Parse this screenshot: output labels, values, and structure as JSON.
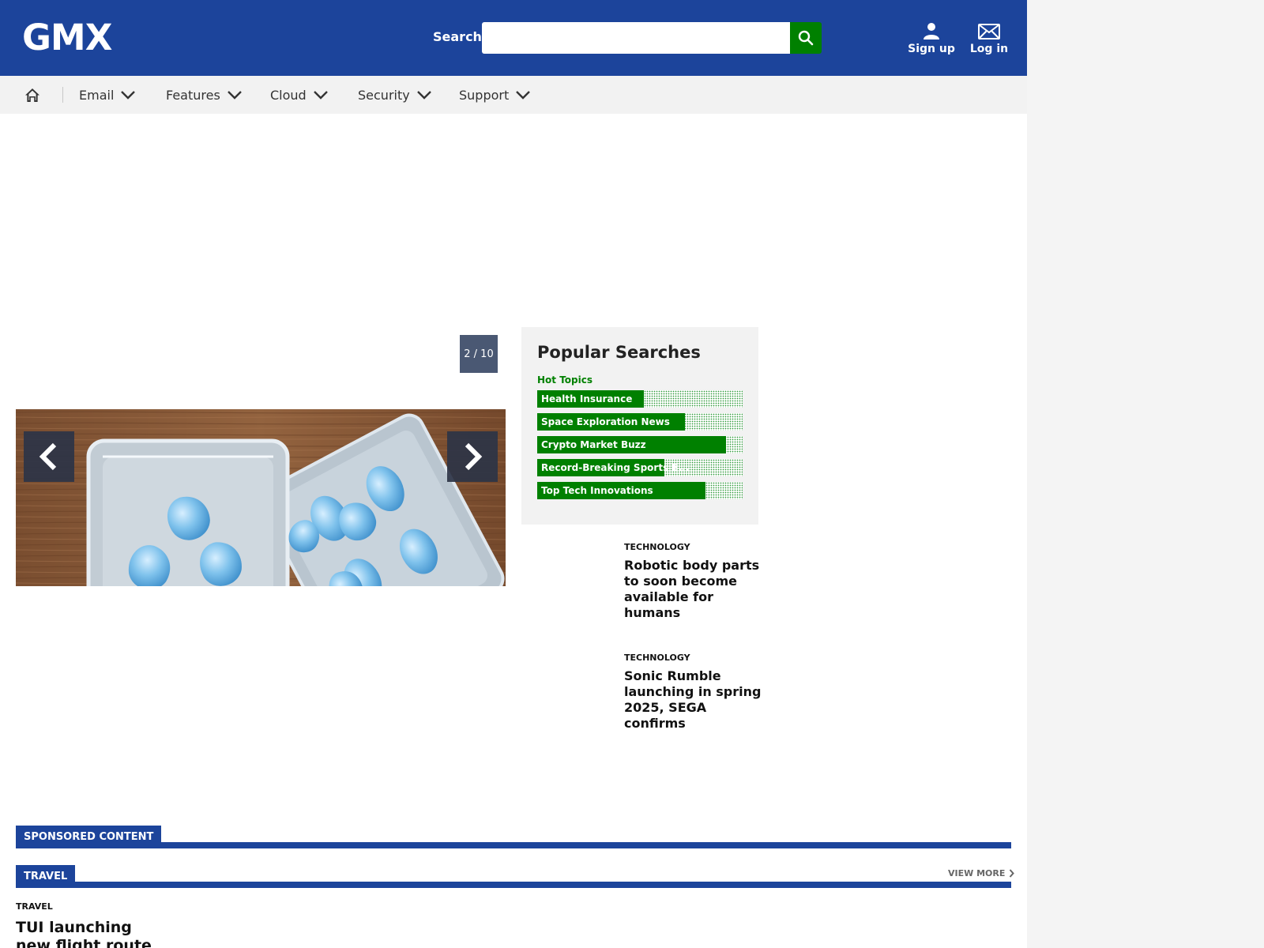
{
  "header": {
    "logo": "GMX",
    "search_label": "Search",
    "search_placeholder": "",
    "signup_label": "Sign up",
    "login_label": "Log in"
  },
  "nav": {
    "items": [
      {
        "label": "Email"
      },
      {
        "label": "Features"
      },
      {
        "label": "Cloud"
      },
      {
        "label": "Security"
      },
      {
        "label": "Support"
      }
    ]
  },
  "slideshow": {
    "counter": "2 / 10"
  },
  "popular": {
    "title": "Popular Searches",
    "subtitle": "Hot Topics",
    "items": [
      {
        "label": "Health Insurance",
        "level": 0.52
      },
      {
        "label": "Space Exploration News",
        "level": 0.72
      },
      {
        "label": "Crypto Market Buzz",
        "level": 0.92
      },
      {
        "label": "Record-Breaking Sports E...",
        "level": 0.62
      },
      {
        "label": "Top Tech Innovations",
        "level": 0.82
      }
    ]
  },
  "articles": [
    {
      "category": "TECHNOLOGY",
      "headline": "Robotic body parts to soon become available for humans"
    },
    {
      "category": "TECHNOLOGY",
      "headline": "Sonic Rumble launching in spring 2025, SEGA confirms"
    }
  ],
  "sponsored": {
    "title": "SPONSORED CONTENT"
  },
  "travel": {
    "title": "TRAVEL",
    "view_more": "VIEW MORE",
    "article": {
      "category": "TRAVEL",
      "headline": "TUI launching new flight route"
    }
  },
  "colors": {
    "brand": "#1c449b",
    "accent": "#008000",
    "nav_bg": "#f2f2f2"
  },
  "icons": {
    "search": "search-icon",
    "signup": "user-icon",
    "login": "envelope-icon",
    "home": "home-icon",
    "dropdown": "chevron-down-icon",
    "prev": "chevron-left-icon",
    "next": "chevron-right-icon"
  }
}
